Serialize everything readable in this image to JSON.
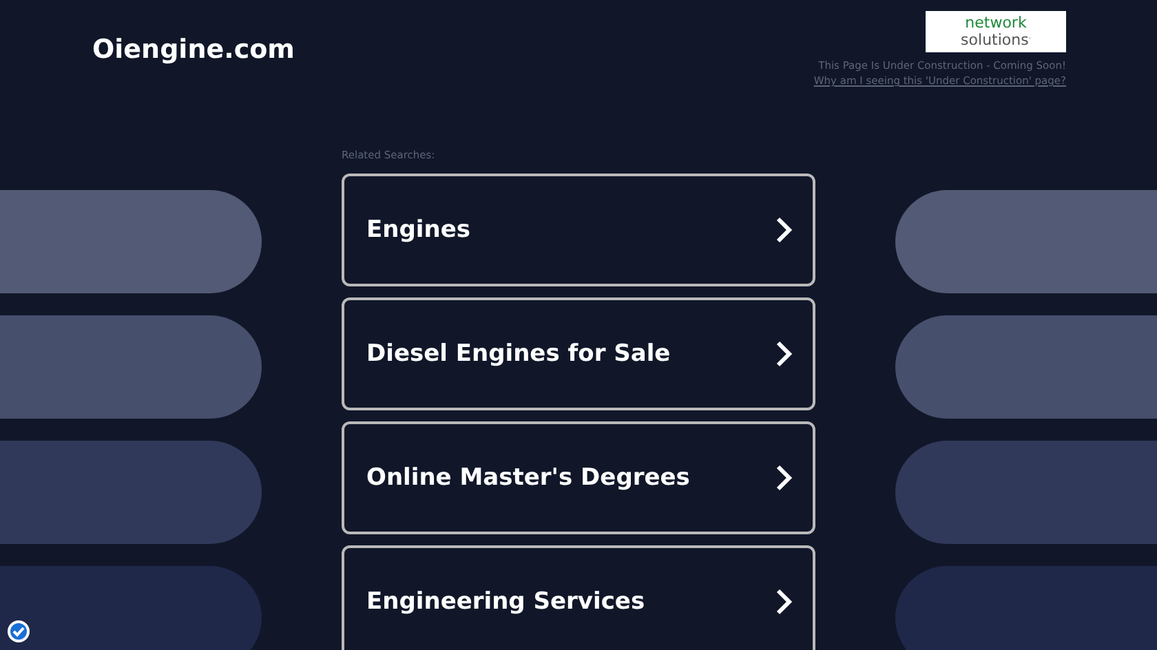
{
  "site_title": "Oiengine.com",
  "badge": {
    "line_1": "network",
    "line_2": "solutions",
    "mark": "."
  },
  "notice": "This Page Is Under Construction - Coming Soon!",
  "notice_link": "Why am I seeing this 'Under Construction' page?",
  "related_label": "Related Searches:",
  "searches": [
    {
      "label": "Engines"
    },
    {
      "label": "Diesel Engines for Sale"
    },
    {
      "label": "Online Master's Degrees"
    },
    {
      "label": "Engineering Services"
    }
  ]
}
